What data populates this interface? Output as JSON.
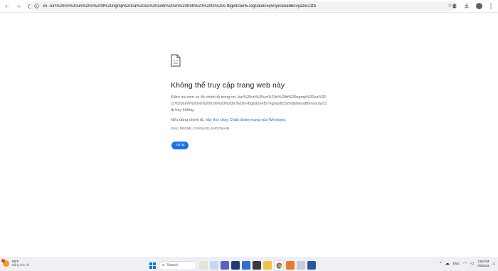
{
  "browser": {
    "url": "xn--lun%20vn%20un%20n%20tt%20ngmp%20ca%20cc%20sinh%20vn%20trnh%20%20tc%20s-fbgx92eef57eg0as8c5y50jo0ana86nvyazw21tb",
    "icons": {
      "back": "arrow-left-icon",
      "forward": "arrow-right-icon",
      "reload": "reload-icon",
      "info": "info-icon",
      "bookmark": "star-icon",
      "extensions": "puzzle-icon",
      "downloads": "download-icon",
      "profile": "avatar-icon",
      "menu": "kebab-menu-icon"
    }
  },
  "error": {
    "icon": "sad-document-icon",
    "title": "Không thể truy cập trang web này",
    "description": "Kiểm tra xem có lỗi chính tả trong xn--lun%20vn%20un%20n%20tt%20ngmp%20ca%20cc%20sinh%20vn%20trnh%20%20tc%20s-fbgx92eef57eg0as8c5y50jo0ana86nvyazw21tb hay không.",
    "hint_prefix": "Nếu đúng chính tả, hãy ",
    "hint_link": "thử chạy Chẩn đoán mạng của Windows",
    "hint_suffix": ".",
    "code": "DNS_PROBE_FINISHED_NXDOMAIN",
    "reload_label": "Tải lại"
  },
  "taskbar": {
    "weather_temp": "59°F",
    "weather_condition": "Nắng nhẹ rải",
    "weather_badge": "1",
    "search_placeholder": "Search",
    "language": "ENG",
    "time": "2:50 PM",
    "date": "7/8/2024"
  },
  "colors": {
    "accent": "#1a73e8",
    "text": "#202124",
    "muted": "#5f6368"
  }
}
